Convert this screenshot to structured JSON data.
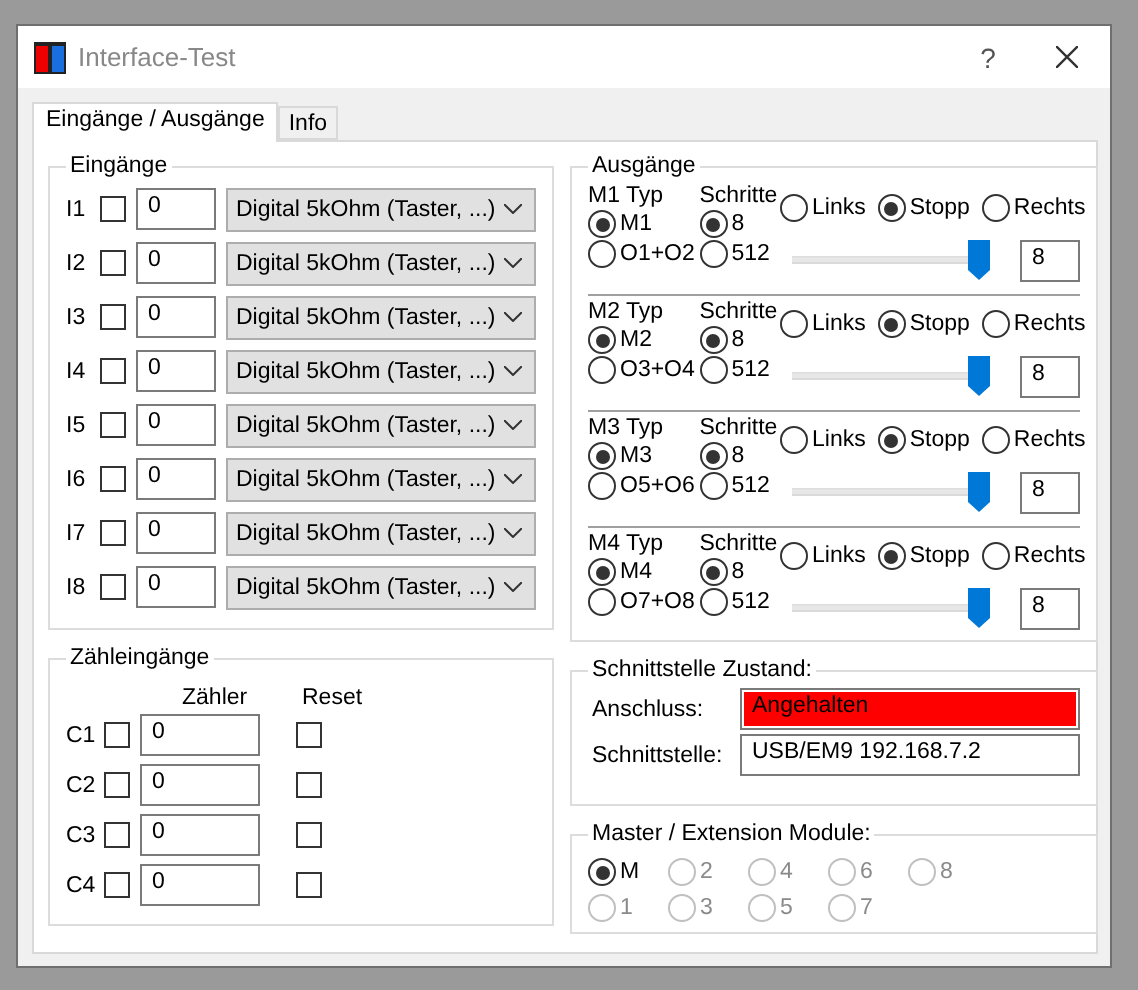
{
  "window": {
    "title": "Interface-Test",
    "help": "?"
  },
  "tabs": [
    {
      "label": "Eingänge / Ausgänge",
      "selected": true
    },
    {
      "label": "Info",
      "selected": false
    }
  ],
  "inputs": {
    "title": "Eingänge",
    "rows": [
      {
        "label": "I1",
        "checked": false,
        "value": "0",
        "mode": "Digital 5kOhm (Taster, ...)"
      },
      {
        "label": "I2",
        "checked": false,
        "value": "0",
        "mode": "Digital 5kOhm (Taster, ...)"
      },
      {
        "label": "I3",
        "checked": false,
        "value": "0",
        "mode": "Digital 5kOhm (Taster, ...)"
      },
      {
        "label": "I4",
        "checked": false,
        "value": "0",
        "mode": "Digital 5kOhm (Taster, ...)"
      },
      {
        "label": "I5",
        "checked": false,
        "value": "0",
        "mode": "Digital 5kOhm (Taster, ...)"
      },
      {
        "label": "I6",
        "checked": false,
        "value": "0",
        "mode": "Digital 5kOhm (Taster, ...)"
      },
      {
        "label": "I7",
        "checked": false,
        "value": "0",
        "mode": "Digital 5kOhm (Taster, ...)"
      },
      {
        "label": "I8",
        "checked": false,
        "value": "0",
        "mode": "Digital 5kOhm (Taster, ...)"
      }
    ]
  },
  "counters": {
    "title": "Zähleingänge",
    "columns": [
      "Zähler",
      "Reset"
    ],
    "rows": [
      {
        "label": "C1",
        "checked": false,
        "value": "0",
        "reset": false
      },
      {
        "label": "C2",
        "checked": false,
        "value": "0",
        "reset": false
      },
      {
        "label": "C3",
        "checked": false,
        "value": "0",
        "reset": false
      },
      {
        "label": "C4",
        "checked": false,
        "value": "0",
        "reset": false
      }
    ]
  },
  "outputs": {
    "title": "Ausgänge",
    "motors": [
      {
        "type_label": "M1 Typ",
        "type_options": [
          {
            "label": "M1",
            "selected": true
          },
          {
            "label": "O1+O2",
            "selected": false
          }
        ],
        "steps_label": "Schritte",
        "steps_options": [
          {
            "label": "8",
            "selected": true
          },
          {
            "label": "512",
            "selected": false
          }
        ],
        "directions": [
          {
            "label": "Links",
            "selected": false
          },
          {
            "label": "Stopp",
            "selected": true
          },
          {
            "label": "Rechts",
            "selected": false
          }
        ],
        "speed": {
          "level": 1
        },
        "speed_value": "8"
      },
      {
        "type_label": "M2 Typ",
        "type_options": [
          {
            "label": "M2",
            "selected": true
          },
          {
            "label": "O3+O4",
            "selected": false
          }
        ],
        "steps_label": "Schritte",
        "steps_options": [
          {
            "label": "8",
            "selected": true
          },
          {
            "label": "512",
            "selected": false
          }
        ],
        "directions": [
          {
            "label": "Links",
            "selected": false
          },
          {
            "label": "Stopp",
            "selected": true
          },
          {
            "label": "Rechts",
            "selected": false
          }
        ],
        "speed": {
          "level": 1
        },
        "speed_value": "8"
      },
      {
        "type_label": "M3 Typ",
        "type_options": [
          {
            "label": "M3",
            "selected": true
          },
          {
            "label": "O5+O6",
            "selected": false
          }
        ],
        "steps_label": "Schritte",
        "steps_options": [
          {
            "label": "8",
            "selected": true
          },
          {
            "label": "512",
            "selected": false
          }
        ],
        "directions": [
          {
            "label": "Links",
            "selected": false
          },
          {
            "label": "Stopp",
            "selected": true
          },
          {
            "label": "Rechts",
            "selected": false
          }
        ],
        "speed": {
          "level": 1
        },
        "speed_value": "8"
      },
      {
        "type_label": "M4 Typ",
        "type_options": [
          {
            "label": "M4",
            "selected": true
          },
          {
            "label": "O7+O8",
            "selected": false
          }
        ],
        "steps_label": "Schritte",
        "steps_options": [
          {
            "label": "8",
            "selected": true
          },
          {
            "label": "512",
            "selected": false
          }
        ],
        "directions": [
          {
            "label": "Links",
            "selected": false
          },
          {
            "label": "Stopp",
            "selected": true
          },
          {
            "label": "Rechts",
            "selected": false
          }
        ],
        "speed": {
          "level": 1
        },
        "speed_value": "8"
      }
    ]
  },
  "interface_status": {
    "title": "Schnittstelle Zustand:",
    "fields": [
      {
        "label": "Anschluss:",
        "value": "Angehalten",
        "alert": true
      },
      {
        "label": "Schnittstelle:",
        "value": "USB/EM9 192.168.7.2",
        "alert": false
      }
    ]
  },
  "modules": {
    "title": "Master / Extension Module:",
    "options": [
      {
        "label": "M",
        "selected": true,
        "disabled": false
      },
      {
        "label": "2",
        "selected": false,
        "disabled": true
      },
      {
        "label": "4",
        "selected": false,
        "disabled": true
      },
      {
        "label": "6",
        "selected": false,
        "disabled": true
      },
      {
        "label": "8",
        "selected": false,
        "disabled": true
      },
      {
        "label": "1",
        "selected": false,
        "disabled": true
      },
      {
        "label": "3",
        "selected": false,
        "disabled": true
      },
      {
        "label": "5",
        "selected": false,
        "disabled": true
      },
      {
        "label": "7",
        "selected": false,
        "disabled": true
      }
    ]
  }
}
